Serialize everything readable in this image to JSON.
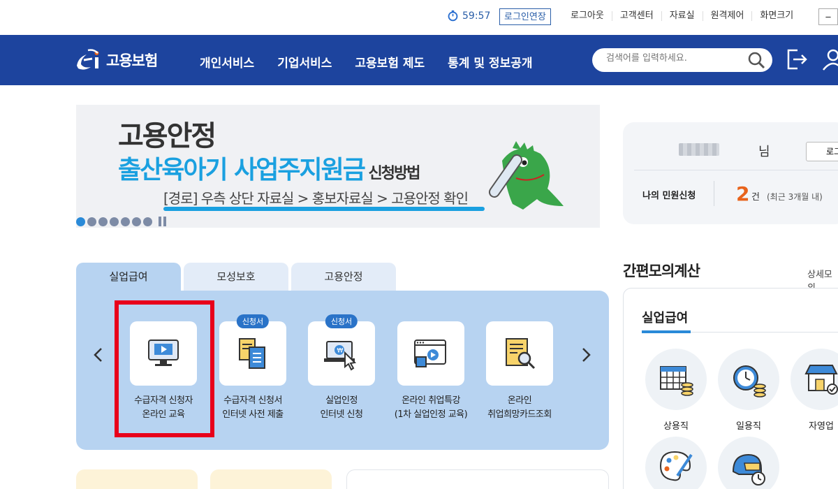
{
  "util": {
    "timer": "59:57",
    "extend": "로그인연장",
    "links": [
      "로그아웃",
      "고객센터",
      "자료실",
      "원격제어",
      "화면크기"
    ],
    "minus": "–"
  },
  "header": {
    "logo": "고용보험",
    "menu": [
      "개인서비스",
      "기업서비스",
      "고용보험 제도",
      "통계 및 정보공개"
    ],
    "search_placeholder": "검색어를 입력하세요."
  },
  "banner": {
    "line1": "고용안정",
    "line2": "출산육아기 사업주지원금",
    "line2_small": " 신청방법",
    "line3": "[경로] 우측 상단 자료실 > 홍보자료실 > 고용안정 확인",
    "dots": 7
  },
  "user": {
    "suffix": "님",
    "login_btn": "로그",
    "label": "나의 민원신청",
    "count": "2",
    "unit": "건",
    "recent": "(최근 3개월 내)"
  },
  "tabs": [
    "실업급여",
    "모성보호",
    "고용안정"
  ],
  "services": [
    {
      "line1": "수급자격 신청자",
      "line2": "온라인 교육",
      "badge": ""
    },
    {
      "line1": "수급자격 신청서",
      "line2": "인터넷 사전 제출",
      "badge": "신청서"
    },
    {
      "line1": "실업인정",
      "line2": "인터넷 신청",
      "badge": "신청서"
    },
    {
      "line1": "온라인 취업특강",
      "line2": "(1차 실업인정 교육)",
      "badge": ""
    },
    {
      "line1": "온라인",
      "line2": "취업희망카드조회",
      "badge": ""
    }
  ],
  "calc": {
    "title": "간편모의계산",
    "more": "상세모의",
    "sub": "실업급여",
    "items": [
      "상용직",
      "일용직",
      "자영업"
    ]
  },
  "colors": {
    "header": "#1d449e",
    "panel": "#b7d3f1",
    "highlight": "#e8001b",
    "accent": "#2a8ad8",
    "count": "#e8631c"
  }
}
